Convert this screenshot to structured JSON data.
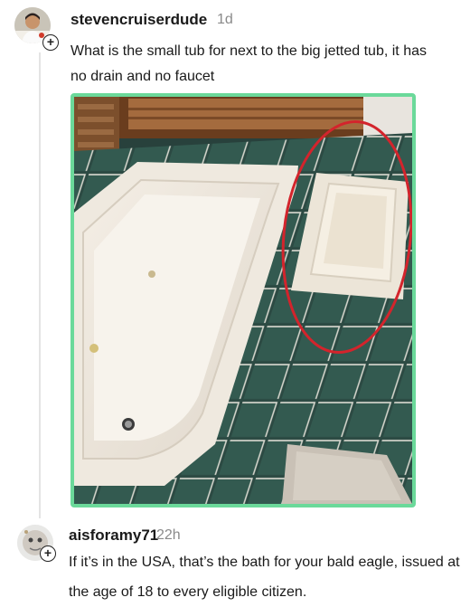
{
  "post": {
    "username": "stevencruiserdude",
    "time": "1d",
    "text": "What is the small tub for next to the big jetted tub, it has no drain and no faucet",
    "image": {
      "icon": "bathroom-photo",
      "accent_color": "#6bd99a",
      "annotation_color": "#d3242c"
    }
  },
  "reply": {
    "username": "aisforamy71",
    "time": "22h",
    "text": "If it’s in the USA, that’s the bath for your bald eagle, issued at the age of 18 to every eligible citizen."
  },
  "icons": {
    "follow": "plus-icon"
  }
}
